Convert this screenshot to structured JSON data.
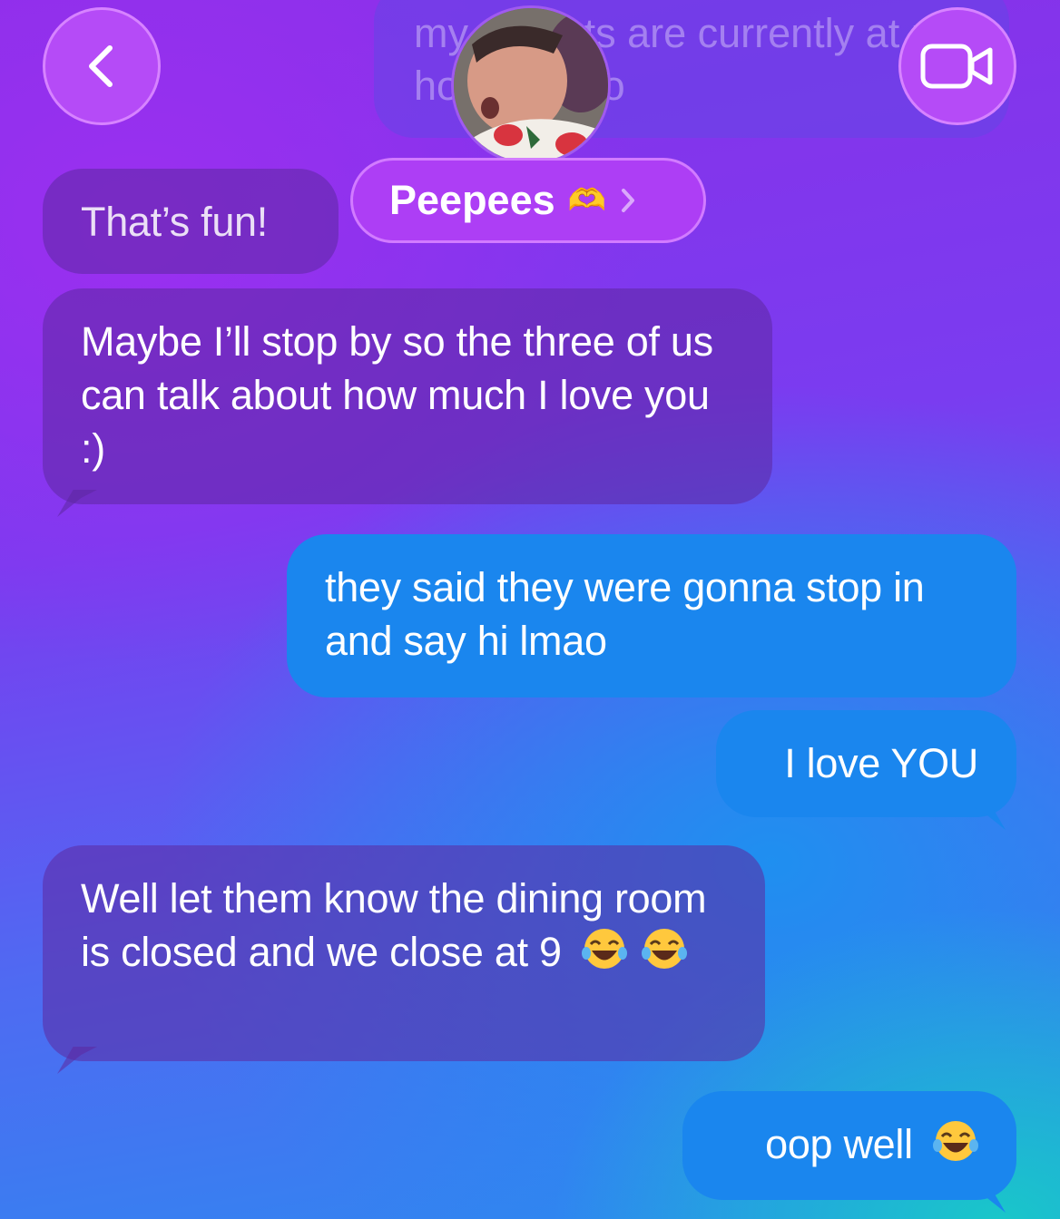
{
  "header": {
    "contact_name": "Peepees",
    "contact_emoji": "🫶",
    "back_icon": "chevron-left-icon",
    "video_icon": "video-camera-icon",
    "hidden_message": "my parents are currently at my house lmao"
  },
  "messages": [
    {
      "direction": "received",
      "text": "That’s fun!"
    },
    {
      "direction": "received",
      "text": "Maybe I’ll stop by so the three of us can talk about how much I love you :)"
    },
    {
      "direction": "sent",
      "text": "they said they were gonna stop in and say hi lmao"
    },
    {
      "direction": "sent",
      "text": "I love YOU"
    },
    {
      "direction": "received",
      "text": "Well let them know the dining room is closed and we close at 9",
      "emoji": [
        "face-with-tears-of-joy",
        "face-with-tears-of-joy"
      ]
    },
    {
      "direction": "sent",
      "text": "oop well",
      "emoji": [
        "face-with-tears-of-joy"
      ]
    }
  ],
  "colors": {
    "sent_bubble": "#1a86ee",
    "received_bubble": "#5c28a0",
    "header_button": "#b54bf7"
  }
}
